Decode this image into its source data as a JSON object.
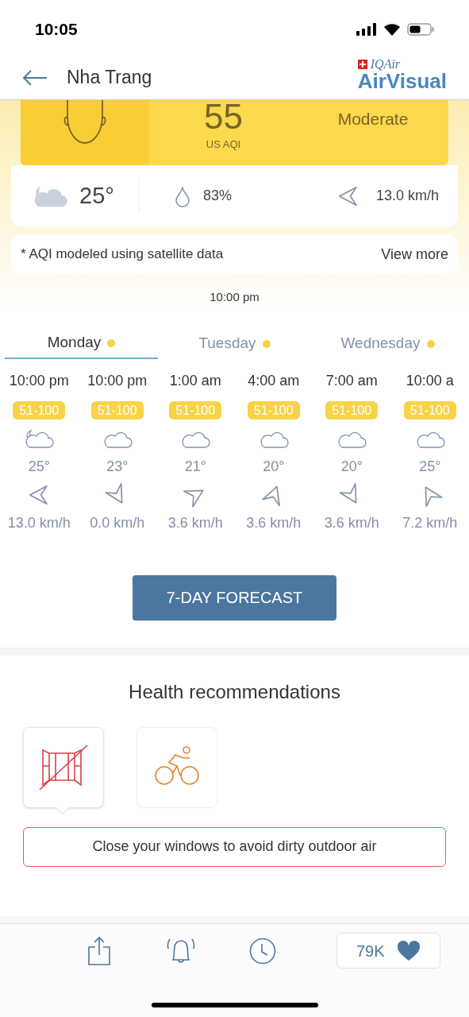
{
  "status_bar": {
    "time": "10:05"
  },
  "header": {
    "title": "Nha Trang",
    "logo_top": "IQAir",
    "logo_bottom": "AirVisual"
  },
  "aqi_card": {
    "value": "55",
    "unit": "US AQI",
    "level_label": "Moderate"
  },
  "weather": {
    "temperature": "25°",
    "humidity": "83%",
    "wind": "13.0 km/h"
  },
  "note": {
    "text": "* AQI modeled using satellite data",
    "link": "View more"
  },
  "updated": "10:00 pm",
  "day_tabs": [
    {
      "label": "Monday",
      "selected": true,
      "color": "#f7d046"
    },
    {
      "label": "Tuesday",
      "selected": false,
      "color": "#f7d046"
    },
    {
      "label": "Wednesday",
      "selected": false,
      "color": "#f7d046"
    }
  ],
  "hourly": [
    {
      "kind": "night",
      "time": "10:00 pm",
      "aqi": "51-100",
      "temp": "25°",
      "wind": "13.0 km/h"
    },
    {
      "kind": "cloud",
      "time": "10:00 pm",
      "aqi": "51-100",
      "temp": "23°",
      "wind": "0.0 km/h"
    },
    {
      "kind": "cloud",
      "time": "1:00 am",
      "aqi": "51-100",
      "temp": "21°",
      "wind": "3.6 km/h"
    },
    {
      "kind": "cloud",
      "time": "4:00 am",
      "aqi": "51-100",
      "temp": "20°",
      "wind": "3.6 km/h"
    },
    {
      "kind": "cloud",
      "time": "7:00 am",
      "aqi": "51-100",
      "temp": "20°",
      "wind": "3.6 km/h"
    },
    {
      "kind": "cloud",
      "time": "10:00 a",
      "aqi": "51-100",
      "temp": "25°",
      "wind": "7.2 km/h"
    }
  ],
  "forecast_button": "7-DAY FORECAST",
  "health": {
    "title": "Health recommendations",
    "items": [
      {
        "kind": "window",
        "selected": true
      },
      {
        "kind": "bike",
        "selected": false
      }
    ],
    "message": "Close your windows to avoid dirty outdoor air"
  },
  "bottom_bar": {
    "likes": "79K"
  }
}
